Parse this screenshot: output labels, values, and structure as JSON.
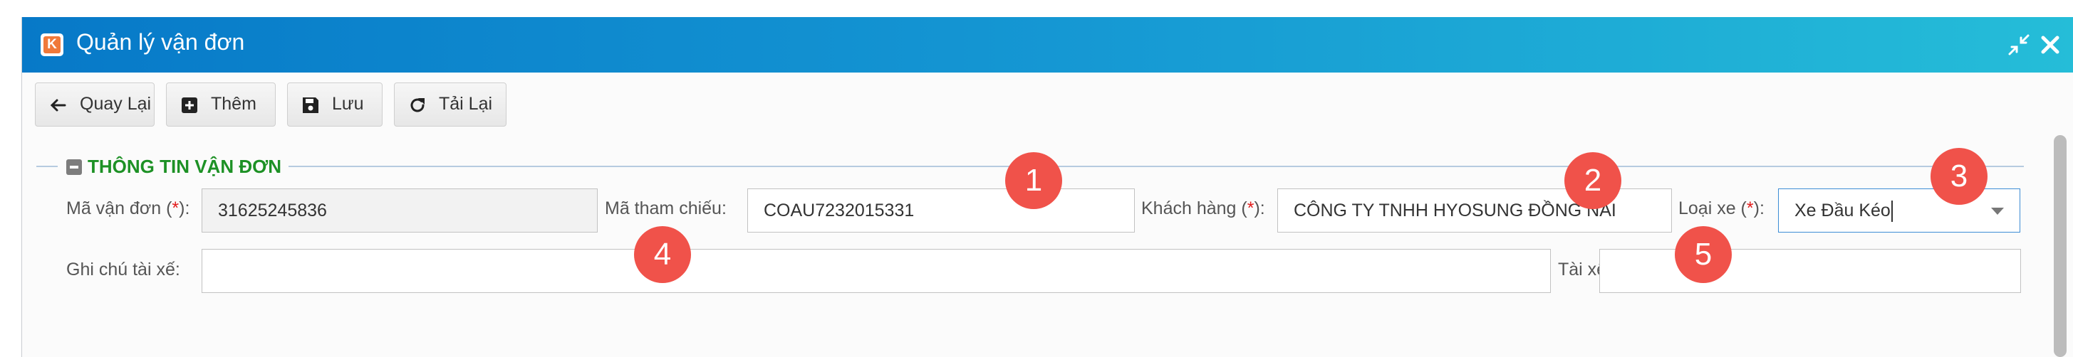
{
  "window": {
    "title": "Quản lý vận đơn",
    "logo_letter": "K",
    "collapse_icon": "shrink-icon",
    "close_icon": "close-icon"
  },
  "toolbar": {
    "back_label": "Quay Lại",
    "add_label": "Thêm",
    "save_label": "Lưu",
    "reload_label": "Tải Lại"
  },
  "section": {
    "title": "THÔNG TIN VẬN ĐƠN"
  },
  "form": {
    "waybill_code": {
      "label": "Mã vận đơn (",
      "req": "*",
      "label_end": "):",
      "value": "31625245836"
    },
    "reference_code": {
      "label": "Mã tham chiếu:",
      "value": "COAU7232015331"
    },
    "customer": {
      "label": "Khách hàng (",
      "req": "*",
      "label_end": "):",
      "value": "CÔNG TY TNHH HYOSUNG ĐỒNG NAI"
    },
    "vehicle_type": {
      "label": "Loại xe (",
      "req": "*",
      "label_end": "):",
      "value": "Xe Đầu Kéo"
    },
    "driver_note": {
      "label": "Ghi chú tài xế:",
      "value": ""
    },
    "driver": {
      "label": "Tài xế:",
      "value": ""
    }
  },
  "badges": [
    "1",
    "2",
    "3",
    "4",
    "5"
  ],
  "colors": {
    "title_gradient_start": "#0779c8",
    "title_gradient_end": "#25bdd8",
    "section_title": "#1d9125",
    "required": "#e21b1b",
    "badge": "#f0524a"
  }
}
